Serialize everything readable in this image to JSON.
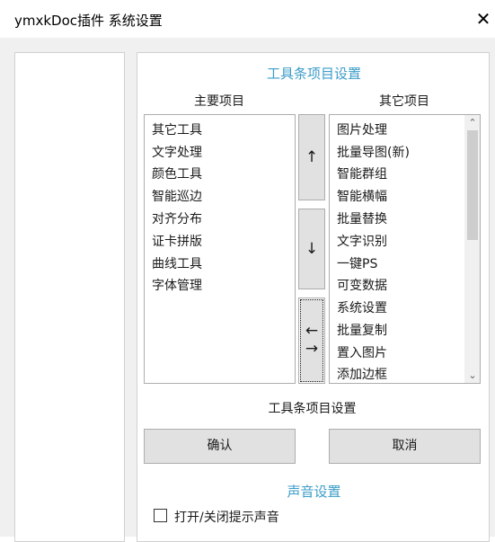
{
  "window": {
    "title": "ymxkDoc插件 系统设置",
    "close_glyph": "✕"
  },
  "toolbar_settings": {
    "section_title": "工具条项目设置",
    "main_label": "主要项目",
    "other_label": "其它项目",
    "main_items": [
      "其它工具",
      "文字处理",
      "颜色工具",
      "智能巡边",
      "对齐分布",
      "证卡拼版",
      "曲线工具",
      "字体管理"
    ],
    "other_items": [
      "图片处理",
      "批量导图(新)",
      "智能群组",
      "智能横幅",
      "批量替换",
      "文字识别",
      "一键PS",
      "可变数据",
      "系统设置",
      "批量复制",
      "置入图片",
      "添加边框"
    ],
    "up_arrow": "↑",
    "down_arrow": "↓",
    "left_arrow": "←",
    "right_arrow": "→",
    "footer_label": "工具条项目设置",
    "ok_label": "确认",
    "cancel_label": "取消"
  },
  "sound_settings": {
    "section_title": "声音设置",
    "checkbox_label": "打开/关闭提示声音",
    "checked": false
  },
  "colors": {
    "accent": "#3c9dc8"
  },
  "icons": {
    "scroll_up": "⌃",
    "scroll_down": "⌄"
  }
}
